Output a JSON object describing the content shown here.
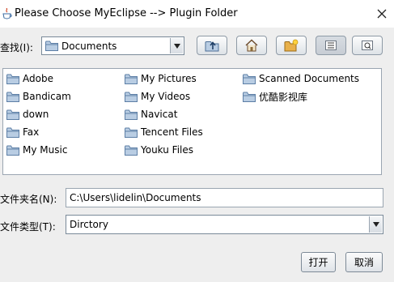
{
  "window": {
    "title": "Please Choose MyEclipse --> Plugin Folder",
    "close_glyph": "✕"
  },
  "lookin": {
    "label": "查找(I):",
    "value": "Documents"
  },
  "toolbar": {
    "buttons": [
      {
        "name": "up-one-level-icon"
      },
      {
        "name": "home-icon"
      },
      {
        "name": "new-folder-icon"
      },
      {
        "name": "list-view-icon"
      },
      {
        "name": "details-view-icon"
      }
    ]
  },
  "files": {
    "columns": [
      [
        "Adobe",
        "Bandicam",
        "down",
        "Fax",
        "My Music"
      ],
      [
        "My Pictures",
        "My Videos",
        "Navicat",
        "Tencent Files",
        "Youku Files"
      ],
      [
        "Scanned Documents",
        "优酷影视库"
      ]
    ]
  },
  "foldername": {
    "label": "文件夹名(N):",
    "value": "C:\\Users\\lidelin\\Documents"
  },
  "filetype": {
    "label": "文件类型(T):",
    "value": "Dirctory"
  },
  "actions": {
    "open": "打开",
    "cancel": "取消"
  },
  "colors": {
    "folder": "#5d7fa6",
    "folder_light": "#b9cde3",
    "accent": "#2f5d8f"
  }
}
